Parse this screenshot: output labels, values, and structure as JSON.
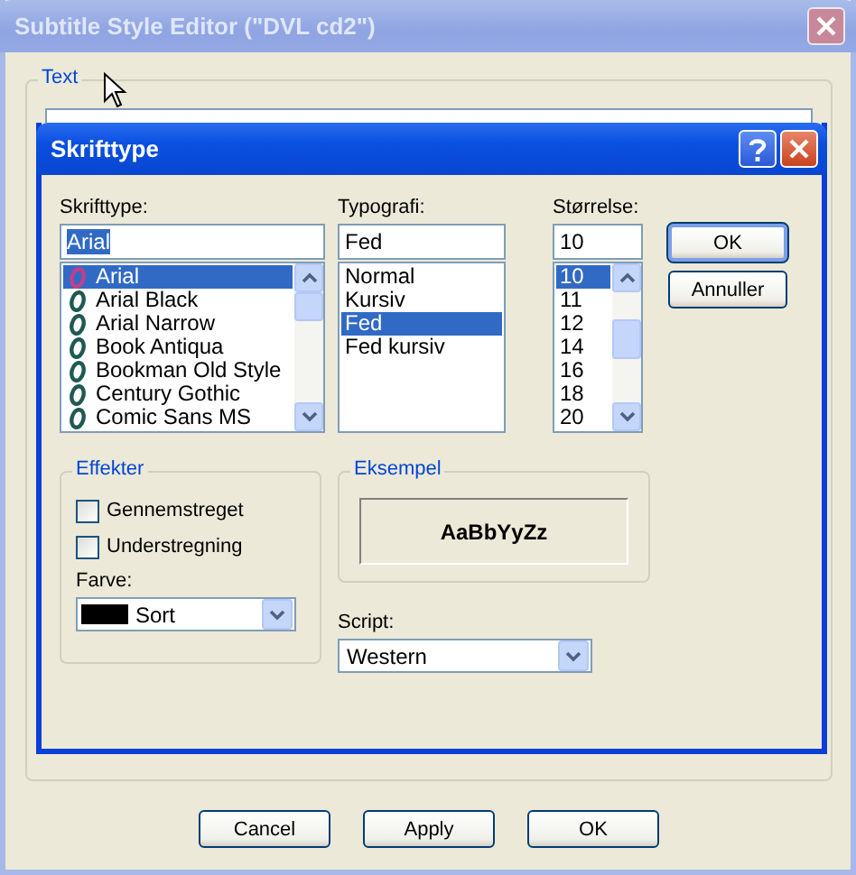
{
  "window": {
    "title": "Subtitle Style Editor (\"DVL cd2\")"
  },
  "text_group": {
    "label": "Text"
  },
  "font_dialog": {
    "title": "Skrifttype",
    "font": {
      "label": "Skrifttype:",
      "value": "Arial",
      "items": [
        {
          "label": "Arial",
          "selected": true
        },
        {
          "label": "Arial Black",
          "selected": false
        },
        {
          "label": "Arial Narrow",
          "selected": false
        },
        {
          "label": "Book Antiqua",
          "selected": false
        },
        {
          "label": "Bookman Old Style",
          "selected": false
        },
        {
          "label": "Century Gothic",
          "selected": false
        },
        {
          "label": "Comic Sans MS",
          "selected": false
        }
      ]
    },
    "style": {
      "label": "Typografi:",
      "value": "Fed",
      "items": [
        {
          "label": "Normal",
          "selected": false
        },
        {
          "label": "Kursiv",
          "selected": false
        },
        {
          "label": "Fed",
          "selected": true
        },
        {
          "label": "Fed kursiv",
          "selected": false
        }
      ]
    },
    "size": {
      "label": "Størrelse:",
      "value": "10",
      "items": [
        {
          "label": "10",
          "selected": true
        },
        {
          "label": "11",
          "selected": false
        },
        {
          "label": "12",
          "selected": false
        },
        {
          "label": "14",
          "selected": false
        },
        {
          "label": "16",
          "selected": false
        },
        {
          "label": "18",
          "selected": false
        },
        {
          "label": "20",
          "selected": false
        }
      ]
    },
    "buttons": [
      "OK",
      "Annuller"
    ],
    "effects": {
      "label": "Effekter",
      "options": [
        {
          "label": "Gennemstreget",
          "checked": false
        },
        {
          "label": "Understregning",
          "checked": false
        }
      ],
      "color_label": "Farve:",
      "color_value": "Sort",
      "color": "#000000"
    },
    "sample": {
      "label": "Eksempel",
      "text": "AaBbYyZz"
    },
    "script": {
      "label": "Script:",
      "value": "Western"
    }
  },
  "buttons": [
    "Cancel",
    "Apply",
    "OK"
  ]
}
